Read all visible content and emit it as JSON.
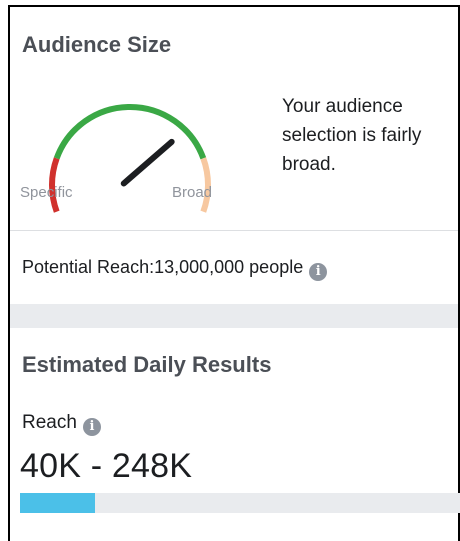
{
  "audience": {
    "title": "Audience Size",
    "gauge": {
      "min_label": "Specific",
      "max_label": "Broad",
      "needle_fraction": 0.7,
      "colors": {
        "low": "#d0312d",
        "mid": "#3aa845",
        "high": "#f7c8a0",
        "needle": "#1c1e21"
      }
    },
    "description": "Your audience selection is fairly broad.",
    "potential_reach": "Potential Reach:13,000,000 people",
    "info_icon": "info-icon"
  },
  "daily_results": {
    "title": "Estimated Daily Results",
    "reach_label": "Reach",
    "reach_range": "40K - 248K",
    "info_icon": "info-icon",
    "progress_fraction": 0.17,
    "progress_color": "#4bc0e8"
  }
}
